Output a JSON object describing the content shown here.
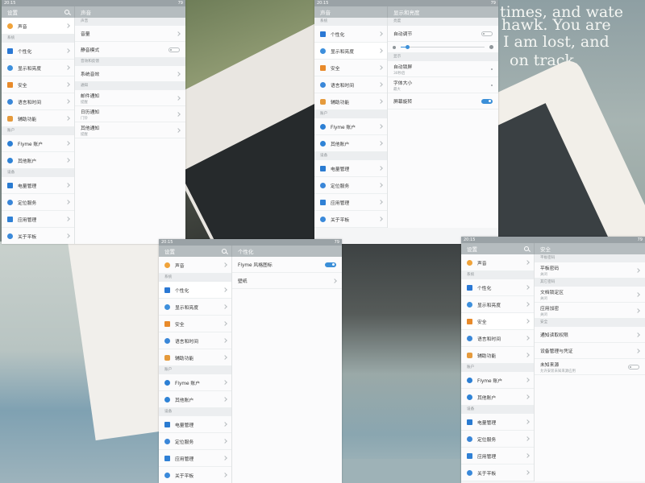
{
  "status": {
    "time": "20:15",
    "battery": "79"
  },
  "sidebar_title": "设置",
  "sidebar_sections": {
    "system": "系统",
    "account": "账户",
    "device": "设备"
  },
  "sidebar_items": {
    "sound": "声音",
    "personalize": "个性化",
    "display": "显示和亮度",
    "security": "安全",
    "language": "语言和时间",
    "accessibility": "辅助功能",
    "flyme": "Flyme 账户",
    "other_accounts": "其他账户",
    "power": "电量管理",
    "location": "定位服务",
    "apps": "应用管理",
    "about": "关于平板"
  },
  "panels": {
    "sound": {
      "title": "声音",
      "sec_sound": "声音",
      "volume": "音量",
      "silent": "静音模式",
      "sec_effects": "音效和反馈",
      "system_sound": "系统音效",
      "sec_notify": "通知",
      "mail": "邮件通知",
      "mail_sub": "提醒",
      "calendar": "日历通知",
      "calendar_sub": "门铃",
      "other": "其他通知",
      "other_sub": "提醒"
    },
    "display": {
      "title": "显示和亮度",
      "sec_brightness": "亮度",
      "auto_adjust": "自动调节",
      "brightness_level": 0.08,
      "sec_display": "显示",
      "auto_lock": "自动锁屏",
      "auto_lock_sub": "30秒后",
      "font_size": "字体大小",
      "font_size_sub": "最大",
      "rotation": "屏幕旋转"
    },
    "personalize": {
      "title": "个性化",
      "flyme_icons": "Flyme 风格图标",
      "wallpaper": "壁纸"
    },
    "security": {
      "title": "安全",
      "sec_pwd": "平板密码",
      "tablet_pwd": "平板密码",
      "tablet_pwd_sub": "关闭",
      "sec_privacy": "其它密码",
      "doc_lock": "文档锁定区",
      "doc_lock_sub": "关闭",
      "app_lock": "应用加密",
      "app_lock_sub": "关闭",
      "sec_security": "安全",
      "notif_access": "通知读取权限",
      "device_mgmt": "设备管理与凭证",
      "unknown_src": "未知来源",
      "unknown_src_sub": "允许安装未知来源应用"
    }
  },
  "handwriting": [
    "times, and wate",
    "hawk. You are",
    "I am lost, and",
    "on track."
  ],
  "colors": {
    "accent": "#3b8fd8",
    "titlebar": "#b5bcbf",
    "statusbar": "#9aa2a6"
  }
}
